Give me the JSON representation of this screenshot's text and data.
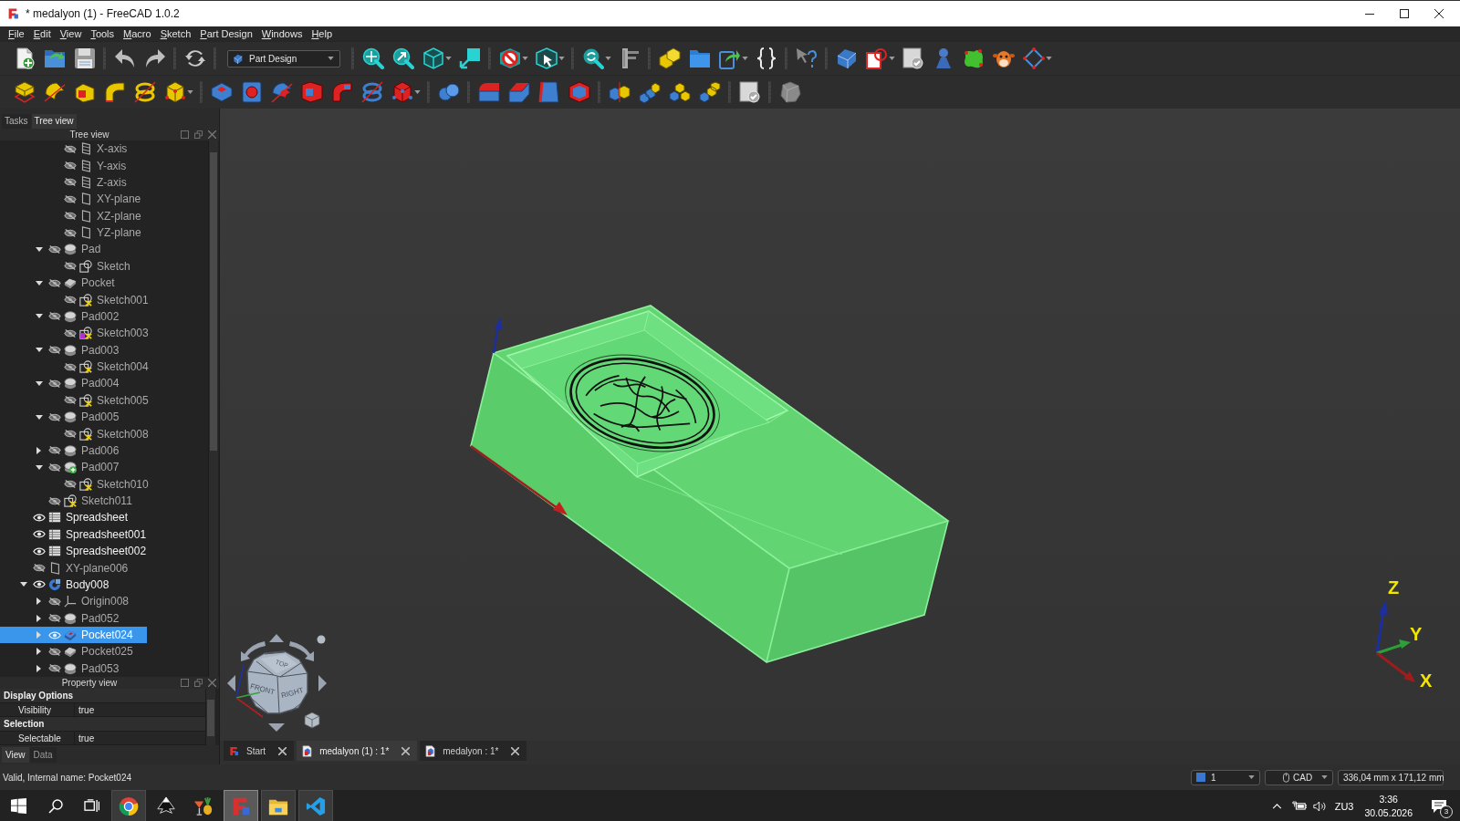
{
  "window": {
    "title": "* medalyon (1) - FreeCAD 1.0.2"
  },
  "menu": [
    "File",
    "Edit",
    "View",
    "Tools",
    "Macro",
    "Sketch",
    "Part Design",
    "Windows",
    "Help"
  ],
  "toolbar": {
    "workbench": "Part Design"
  },
  "left_panel": {
    "tabs": [
      {
        "label": "Tasks",
        "selected": false
      },
      {
        "label": "Tree view",
        "selected": true
      }
    ],
    "tree_view": {
      "title": "Tree view",
      "items": [
        {
          "children": [
            {
              "children": [
                {
                  "label": "X-axis",
                  "kind": "axis",
                  "visible": false,
                  "selected": false
                },
                {
                  "label": "Y-axis",
                  "kind": "axis",
                  "visible": false,
                  "selected": false
                },
                {
                  "label": "Z-axis",
                  "kind": "axis",
                  "visible": false,
                  "selected": false
                },
                {
                  "label": "XY-plane",
                  "kind": "plane",
                  "visible": false,
                  "selected": false
                },
                {
                  "label": "XZ-plane",
                  "kind": "plane",
                  "visible": false,
                  "selected": false
                },
                {
                  "label": "YZ-plane",
                  "kind": "plane",
                  "visible": false,
                  "selected": false
                }
              ]
            },
            {
              "label": "Pad",
              "kind": "pad",
              "visible": false,
              "selected": false,
              "expanded": true,
              "children": [
                {
                  "label": "Sketch",
                  "kind": "sketch",
                  "visible": false,
                  "selected": false
                }
              ]
            },
            {
              "label": "Pocket",
              "kind": "pocket",
              "visible": false,
              "selected": false,
              "expanded": true,
              "children": [
                {
                  "label": "Sketch001",
                  "kind": "sketchcross",
                  "visible": false,
                  "selected": false
                }
              ]
            },
            {
              "label": "Pad002",
              "kind": "pad",
              "visible": false,
              "selected": false,
              "expanded": true,
              "children": [
                {
                  "label": "Sketch003",
                  "kind": "sketchcrosspurple",
                  "visible": false,
                  "selected": false
                }
              ]
            },
            {
              "label": "Pad003",
              "kind": "pad",
              "visible": false,
              "selected": false,
              "expanded": true,
              "children": [
                {
                  "label": "Sketch004",
                  "kind": "sketchcross",
                  "visible": false,
                  "selected": false
                }
              ]
            },
            {
              "label": "Pad004",
              "kind": "pad",
              "visible": false,
              "selected": false,
              "expanded": true,
              "children": [
                {
                  "label": "Sketch005",
                  "kind": "sketchcross",
                  "visible": false,
                  "selected": false
                }
              ]
            },
            {
              "label": "Pad005",
              "kind": "pad",
              "visible": false,
              "selected": false,
              "expanded": true,
              "children": [
                {
                  "label": "Sketch008",
                  "kind": "sketchcross",
                  "visible": false,
                  "selected": false
                }
              ]
            },
            {
              "label": "Pad006",
              "kind": "pad",
              "visible": false,
              "selected": false,
              "expanded": false
            },
            {
              "label": "Pad007",
              "kind": "padplus",
              "visible": false,
              "selected": false,
              "expanded": true,
              "children": [
                {
                  "label": "Sketch010",
                  "kind": "sketchcross",
                  "visible": false,
                  "selected": false
                }
              ]
            },
            {
              "label": "Sketch011",
              "kind": "sketchcross",
              "visible": false,
              "selected": false
            }
          ]
        },
        {
          "label": "Spreadsheet",
          "kind": "spreadsheet",
          "visible": true,
          "selected": false
        },
        {
          "label": "Spreadsheet001",
          "kind": "spreadsheet",
          "visible": true,
          "selected": false
        },
        {
          "label": "Spreadsheet002",
          "kind": "spreadsheet",
          "visible": true,
          "selected": false
        },
        {
          "label": "XY-plane006",
          "kind": "plane",
          "visible": false,
          "selected": false
        },
        {
          "label": "Body008",
          "kind": "body",
          "visible": true,
          "selected": false,
          "expanded": true,
          "children": [
            {
              "label": "Origin008",
              "kind": "origin",
              "visible": false,
              "selected": false,
              "expanded": false
            },
            {
              "label": "Pad052",
              "kind": "pad",
              "visible": false,
              "selected": false,
              "expanded": false
            },
            {
              "label": "Pocket024",
              "kind": "pocket",
              "visible": true,
              "selected": true,
              "expanded": false
            },
            {
              "label": "Pocket025",
              "kind": "pocket",
              "visible": false,
              "selected": false,
              "expanded": false
            },
            {
              "label": "Pad053",
              "kind": "pad",
              "visible": false,
              "selected": false,
              "expanded": false
            }
          ]
        }
      ]
    },
    "property_view": {
      "title": "Property view",
      "groups": [
        {
          "name": "Display Options",
          "rows": [
            {
              "name": "Visibility",
              "value": "true"
            }
          ]
        },
        {
          "name": "Selection",
          "rows": [
            {
              "name": "Selectable",
              "value": "true"
            }
          ]
        }
      ],
      "tabs": [
        {
          "label": "View",
          "selected": true
        },
        {
          "label": "Data",
          "selected": false
        }
      ]
    }
  },
  "viewport": {
    "nav_cube": {
      "faces": [
        "TOP",
        "FRONT",
        "RIGHT"
      ]
    },
    "axis_labels": [
      "Z",
      "Y",
      "X"
    ]
  },
  "document_tabs": [
    {
      "label": "Start",
      "kind": "start",
      "selected": false
    },
    {
      "label": "medalyon (1) : 1*",
      "kind": "document",
      "selected": true
    },
    {
      "label": "medalyon : 1*",
      "kind": "document",
      "selected": false
    }
  ],
  "status_bar": {
    "message": "Valid, Internal name: Pocket024",
    "controls": [
      {
        "kind": "views",
        "label": "1"
      },
      {
        "kind": "navigation",
        "label": "CAD"
      },
      {
        "kind": "size",
        "label": "336,04 mm x 171,12 mm"
      }
    ]
  },
  "taskbar": {
    "apps": [
      {
        "open": true,
        "selected": false
      },
      {
        "open": false,
        "selected": false
      },
      {
        "open": false,
        "selected": false
      },
      {
        "open": true,
        "selected": true
      },
      {
        "open": true,
        "selected": false
      },
      {
        "open": true,
        "selected": false
      }
    ],
    "tray": {
      "language": "ZU3",
      "time": "3:36",
      "date": "30.05.2026",
      "notifications": "3"
    }
  }
}
